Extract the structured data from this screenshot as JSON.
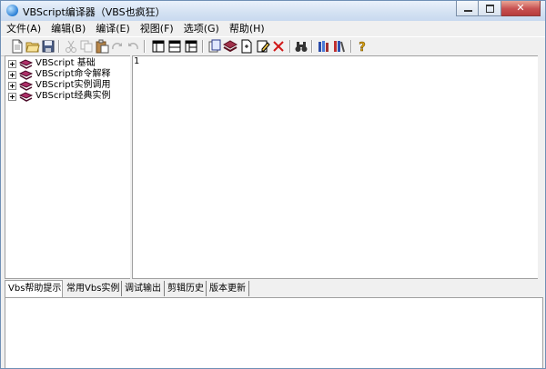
{
  "window": {
    "title": "VBScript编译器（VBS也疯狂）"
  },
  "menu": [
    "文件(A)",
    "编辑(B)",
    "编译(E)",
    "视图(F)",
    "选项(G)",
    "帮助(H)"
  ],
  "toolbar_icons": [
    "new-file-icon",
    "open-folder-icon",
    "save-icon",
    "cut-icon",
    "copy-icon",
    "paste-icon",
    "redo-icon",
    "undo-icon",
    "layout-1-icon",
    "layout-2-icon",
    "layout-3-icon",
    "book-copy-icon",
    "books-icon",
    "new-doc-icon",
    "edit-doc-icon",
    "delete-icon",
    "find-binoculars-icon",
    "library-icon",
    "bookmarks-icon",
    "help-icon"
  ],
  "tree": {
    "items": [
      {
        "label": "VBScript 基础"
      },
      {
        "label": "VBScript命令解释"
      },
      {
        "label": "VBScript实例调用"
      },
      {
        "label": "VBScript经典实例"
      }
    ]
  },
  "editor": {
    "line_number": "1"
  },
  "tabs": [
    {
      "label": "Vbs帮助提示",
      "active": true
    },
    {
      "label": "常用Vbs实例"
    },
    {
      "label": "调试输出"
    },
    {
      "label": "剪辑历史"
    },
    {
      "label": "版本更新"
    }
  ]
}
